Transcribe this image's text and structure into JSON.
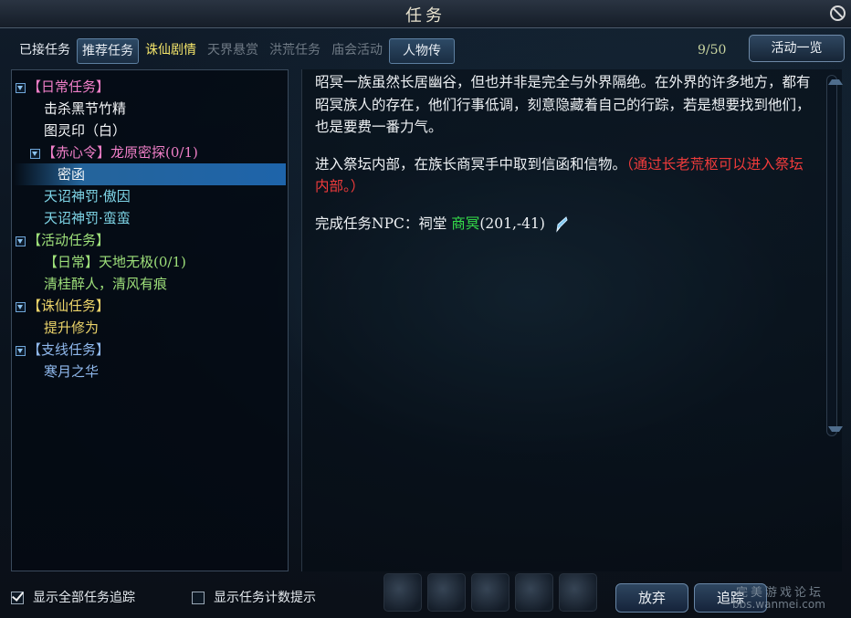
{
  "window": {
    "title": "任务"
  },
  "tabs": [
    {
      "label": "已接任务",
      "state": "normal"
    },
    {
      "label": "推荐任务",
      "state": "active"
    },
    {
      "label": "诛仙剧情",
      "state": "accent"
    },
    {
      "label": "天界悬赏",
      "state": "dim"
    },
    {
      "label": "洪荒任务",
      "state": "dim"
    },
    {
      "label": "庙会活动",
      "state": "dim"
    },
    {
      "label": "人物传",
      "state": "active"
    }
  ],
  "counter": "9/50",
  "activity_button": "活动一览",
  "tree": {
    "daily_header": "【日常任务】",
    "daily_items": [
      "击杀黑节竹精",
      "图灵印（白）"
    ],
    "chixin_header": "【赤心令】龙原密探(0/1)",
    "chixin_child": "密函",
    "daily_items_2": [
      "天诏神罚·傲因",
      "天诏神罚·蛮蛮"
    ],
    "event_header": "【活动任务】",
    "event_sub": "【日常】天地无极(0/1)",
    "event_item": "清桂醉人，清风有痕",
    "zhuxian_header": "【诛仙任务】",
    "zhuxian_item": "提升修为",
    "branch_header": "【支线任务】",
    "branch_item": "寒月之华"
  },
  "detail": {
    "paragraph_1": "昭冥一族虽然长居幽谷，但也并非是完全与外界隔绝。在外界的许多地方，都有昭冥族人的存在，他们行事低调，刻意隐藏着自己的行踪，若是想要找到他们，也是要费一番力气。",
    "paragraph_2_main": "进入祭坛内部，在族长商冥手中取到信函和信物。",
    "paragraph_2_hint": "（通过长老荒枢可以进入祭坛内部。）",
    "npc_label": "完成任务NPC：祠堂",
    "npc_name": "商冥",
    "npc_coords": "(201,-41)"
  },
  "bottom": {
    "show_all_tracking": {
      "label": "显示全部任务追踪",
      "checked": true
    },
    "show_count_hint": {
      "label": "显示任务计数提示",
      "checked": false
    },
    "abandon_button": "放弃",
    "track_button": "追踪"
  },
  "watermark": {
    "line1": "完美游戏论坛",
    "line2": "bbs.wanmei.com"
  },
  "colors": {
    "category_pink": "#f07fc8",
    "category_gold": "#ecd46a",
    "category_blue": "#8fb8ec",
    "item_cyan": "#7fd6e8",
    "item_green": "#9ee07a",
    "hint_red": "#ef3b3b",
    "npc_green": "#36e04a",
    "selected_bg": "#1e64aa"
  }
}
